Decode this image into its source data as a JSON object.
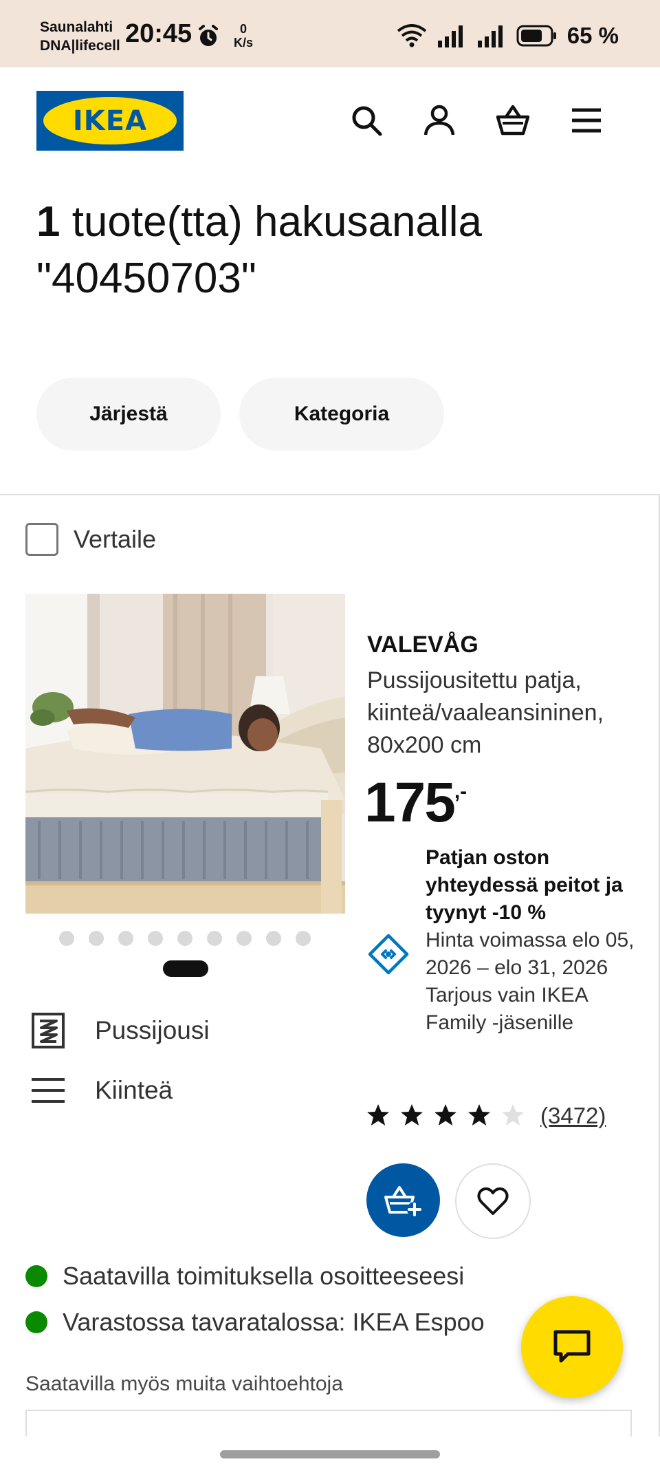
{
  "status_bar": {
    "carrier_line1": "Saunalahti",
    "carrier_line2": "DNA|lifecell",
    "time": "20:45",
    "speed_value": "0",
    "speed_unit": "K/s",
    "battery": "65 %"
  },
  "header": {
    "logo_text": "IKEA",
    "icons": [
      "search-icon",
      "account-icon",
      "cart-icon",
      "menu-icon"
    ]
  },
  "results": {
    "count": "1",
    "text_line1": " tuote(tta) hakusanalla",
    "text_line2": "\"40450703\""
  },
  "filters": {
    "sort_label": "Järjestä",
    "category_label": "Kategoria"
  },
  "product": {
    "compare_label": "Vertaile",
    "name": "VALEVÅG",
    "description": "Pussijousitettu patja, kiinteä/vaaleansininen, 80x200 cm",
    "price_main": "175",
    "price_suffix": ",-",
    "image_count": 9,
    "features": [
      {
        "icon": "pocket-spring-icon",
        "label": "Pussijousi"
      },
      {
        "icon": "firmness-icon",
        "label": "Kiinteä"
      }
    ],
    "offer": {
      "title": "Patjan oston yhteydessä peitot ja tyynyt -10 %",
      "validity": "Hinta voimassa elo 05, 2026 – elo 31, 2026",
      "members": "Tarjous vain IKEA Family -jäsenille"
    },
    "rating": 4,
    "rating_max": 5,
    "reviews": "(3472)",
    "availability": [
      "Saatavilla toimituksella osoitteeseesi",
      "Varastossa tavaratalossa: IKEA Espoo"
    ],
    "other_options": "Saatavilla myös muita vaihtoehtoja"
  },
  "colors": {
    "brand_blue": "#0058a3",
    "brand_yellow": "#ffdb00",
    "available_green": "#0a8a00"
  }
}
